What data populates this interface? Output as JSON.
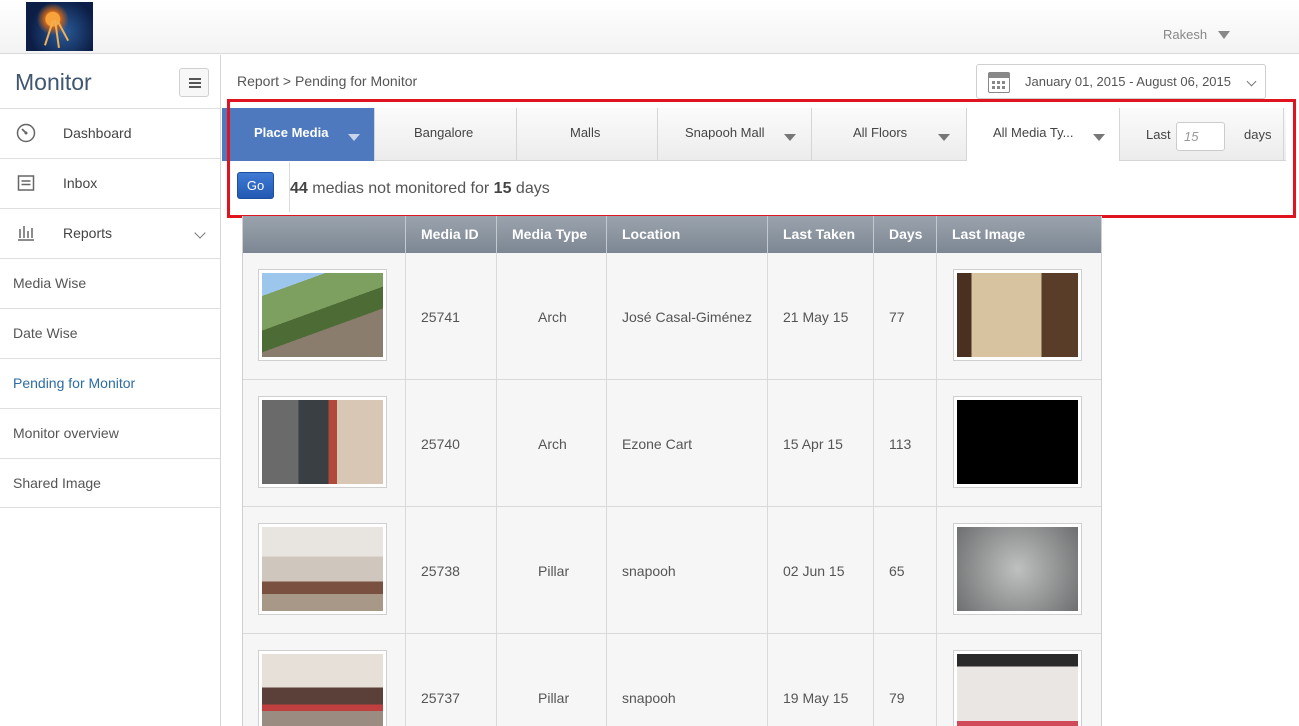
{
  "header": {
    "user_name": "Rakesh"
  },
  "sidebar": {
    "title": "Monitor",
    "items": [
      {
        "label": "Dashboard",
        "icon": "dashboard-icon"
      },
      {
        "label": "Inbox",
        "icon": "inbox-icon"
      },
      {
        "label": "Reports",
        "icon": "reports-icon"
      }
    ],
    "report_sub_items": [
      {
        "label": "Media Wise"
      },
      {
        "label": "Date Wise"
      },
      {
        "label": "Pending for Monitor"
      },
      {
        "label": "Monitor overview"
      },
      {
        "label": "Shared Image"
      }
    ]
  },
  "breadcrumb": "Report > Pending for Monitor",
  "date_range": "January 01, 2015 - August 06, 2015",
  "filters": {
    "place_media": "Place Media",
    "city": "Bangalore",
    "category": "Malls",
    "mall": "Snapooh Mall",
    "floors": "All Floors",
    "media_type": "All Media Ty...",
    "last_label": "Last",
    "days_placeholder": "15",
    "days_label": "days",
    "go_label": "Go"
  },
  "summary": {
    "count": "44",
    "middle": " medias not monitored for ",
    "days": "15",
    "suffix": " days"
  },
  "table": {
    "columns": [
      "",
      "Media ID",
      "Media Type",
      "Location",
      "Last Taken",
      "Days",
      "Last Image"
    ],
    "rows": [
      {
        "media_id": "25741",
        "media_type": "Arch",
        "location": "José Casal-Giménez",
        "last_taken": "21 May 15",
        "days": "77"
      },
      {
        "media_id": "25740",
        "media_type": "Arch",
        "location": "Ezone Cart",
        "last_taken": "15 Apr 15",
        "days": "113"
      },
      {
        "media_id": "25738",
        "media_type": "Pillar",
        "location": "snapooh",
        "last_taken": "02 Jun 15",
        "days": "65"
      },
      {
        "media_id": "25737",
        "media_type": "Pillar",
        "location": "snapooh",
        "last_taken": "19 May 15",
        "days": "79"
      }
    ]
  }
}
